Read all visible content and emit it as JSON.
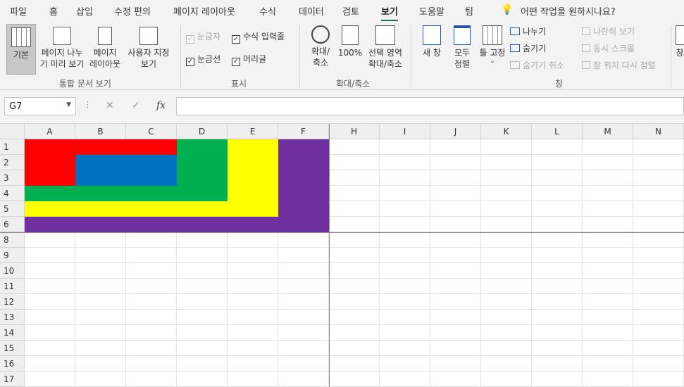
{
  "tabs": [
    "파일",
    "홈",
    "삽입",
    "수정 편의",
    "페이지 레이아웃",
    "수식",
    "데이터",
    "검토",
    "보기",
    "도움말",
    "팀"
  ],
  "active_tab": "보기",
  "tell_me": "어떤 작업을 원하시나요?",
  "ribbon": {
    "views": {
      "normal": "기본",
      "page_break": "페이지 나누\n기 미리 보기",
      "page_layout": "페이지\n레이아웃",
      "custom": "사용자 지정\n보기",
      "group": "통합 문서 보기"
    },
    "show": {
      "ruler": "눈금자",
      "gridlines": "눈금선",
      "formula_bar": "수식 입력줄",
      "headings": "머리글",
      "group": "표시"
    },
    "zoom": {
      "zoom": "확대/\n축소",
      "hundred": "100%",
      "zoom_sel": "선택 영역\n확대/축소",
      "group": "확대/축소"
    },
    "window": {
      "new_window": "새 창",
      "arrange_all": "모두\n정렬",
      "freeze": "틀 고정",
      "split": "나누기",
      "hide": "숨기기",
      "unhide": "숨기기 취소",
      "side_by_side": "나란히 보기",
      "sync_scroll": "동시 스크롤",
      "reset_pos": "창 위치 다시 정렬",
      "switch": "창",
      "group": "창"
    }
  },
  "name_box": "G7",
  "formula_buttons": {
    "cancel": "✕",
    "enter": "✓",
    "fx": "fx"
  },
  "columns": [
    "A",
    "B",
    "C",
    "D",
    "E",
    "F",
    "H",
    "I",
    "J",
    "K",
    "L",
    "M",
    "N"
  ],
  "rows": [
    "1",
    "2",
    "3",
    "4",
    "5",
    "6",
    "8",
    "9",
    "10",
    "11",
    "12",
    "13",
    "14",
    "15",
    "16",
    "17"
  ],
  "colors": {
    "red": "#ff0000",
    "blue": "#0070c0",
    "green": "#00b050",
    "yellow": "#ffff00",
    "purple": "#7030a0",
    "accent": "#217346"
  }
}
